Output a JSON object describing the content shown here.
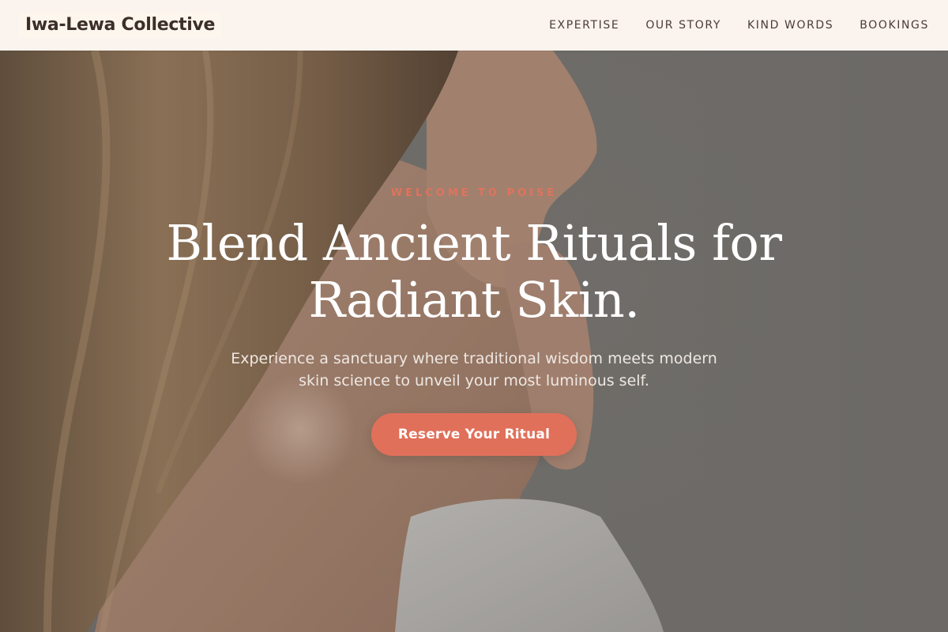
{
  "header": {
    "brand": "Iwa-Lewa Collective",
    "nav": [
      {
        "label": "EXPERTISE"
      },
      {
        "label": "OUR STORY"
      },
      {
        "label": "KIND WORDS"
      },
      {
        "label": "BOOKINGS"
      }
    ]
  },
  "hero": {
    "eyebrow": "WELCOME TO POISE",
    "headline_line1": "Blend Ancient Rituals for",
    "headline_line2": "Radiant Skin.",
    "subtext_line1": "Experience a sanctuary where traditional wisdom meets modern",
    "subtext_line2": "skin science to unveil your most luminous self.",
    "cta_label": "Reserve Your Ritual"
  },
  "colors": {
    "accent": "#e0705a",
    "header_bg": "#fbf3ee",
    "text_dark": "#3c2f2a"
  }
}
